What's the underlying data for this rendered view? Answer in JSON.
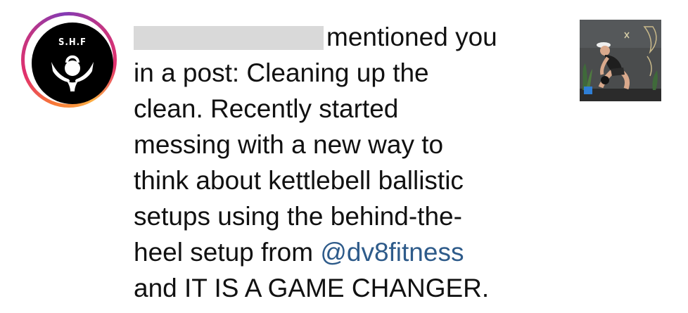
{
  "notification": {
    "avatar": {
      "initials": "S.H.F",
      "logo_icon": "kettlebell-hands-icon",
      "ring_style": "story-ring"
    },
    "message": {
      "line1_suffix": "mentioned you",
      "line2": "in a post: Cleaning up the",
      "line3": "clean. Recently started",
      "line4": "messing with a new way to",
      "line5": "think about kettlebell ballistic",
      "line6": "setups using the behind-the-",
      "line7_prefix": "heel setup from ",
      "mention": "@dv8fitness",
      "line8": "and IT IS A GAME CHANGER."
    },
    "colors": {
      "mention": "#2e5b8a",
      "redaction": "#d9d9d9",
      "ring_start": "#f77737",
      "ring_mid": "#e1306c",
      "ring_end": "#833ab4"
    }
  }
}
